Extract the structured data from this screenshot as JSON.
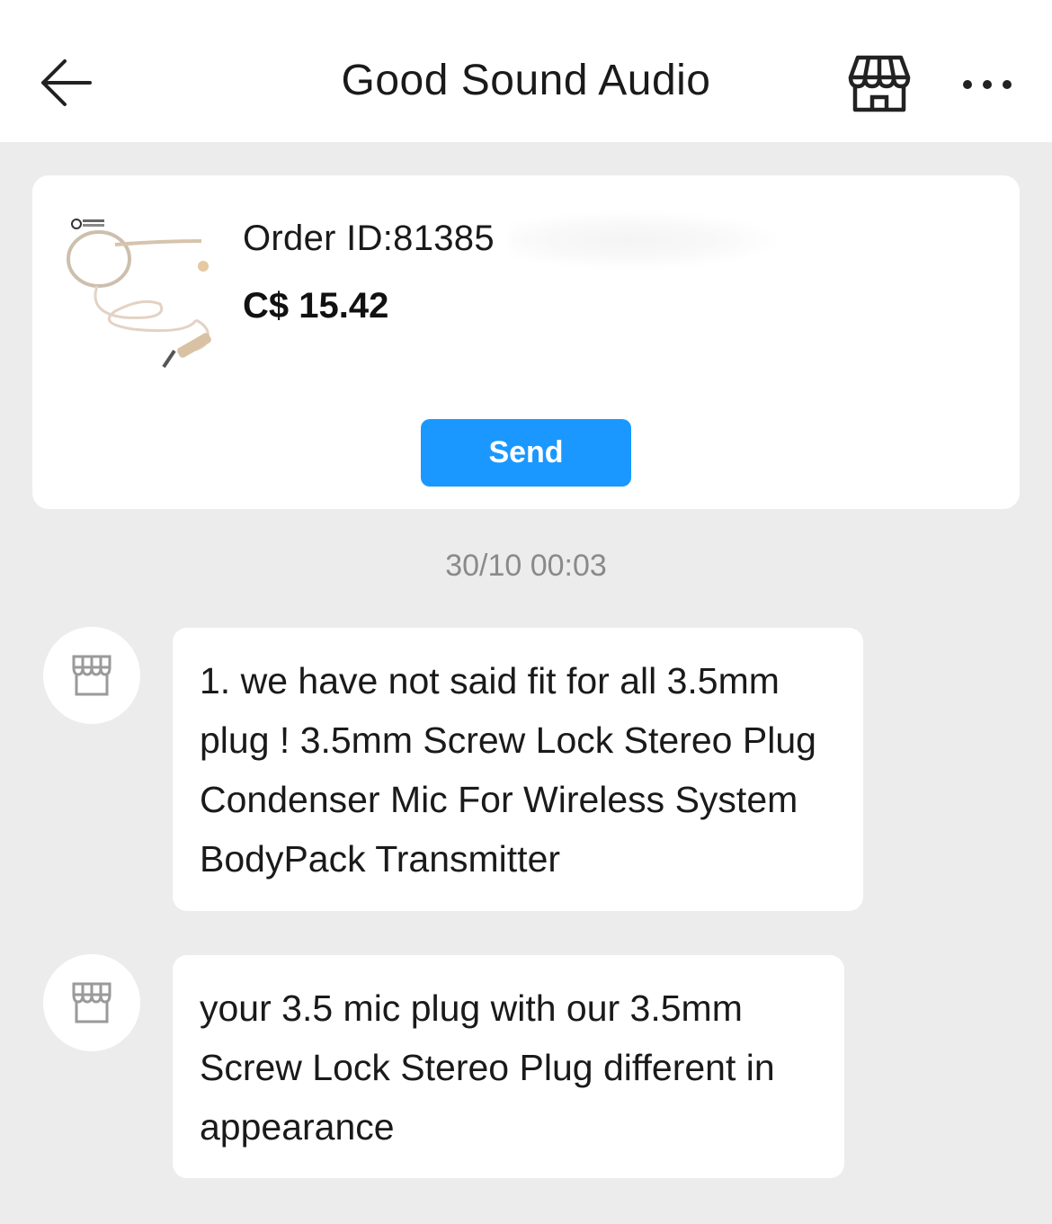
{
  "header": {
    "title": "Good Sound Audio",
    "back_icon": "arrow-left-icon",
    "store_icon": "storefront-icon",
    "more_icon": "more-horizontal-icon"
  },
  "order_card": {
    "order_id": "Order ID:81385",
    "price": "C$ 15.42",
    "send_label": "Send"
  },
  "chat": {
    "timestamp": "30/10 00:03",
    "messages": [
      {
        "sender_icon": "storefront-icon",
        "text": "1. we have not said fit for all 3.5mm plug !  3.5mm Screw Lock Stereo Plug Condenser Mic For Wireless System BodyPack Transmitter"
      },
      {
        "sender_icon": "storefront-icon",
        "text": "your 3.5 mic plug with our 3.5mm Screw Lock Stereo Plug different in appearance"
      }
    ]
  },
  "colors": {
    "accent": "#1a98ff",
    "background": "#ececec",
    "card": "#ffffff",
    "muted_text": "#8a8a8a"
  }
}
